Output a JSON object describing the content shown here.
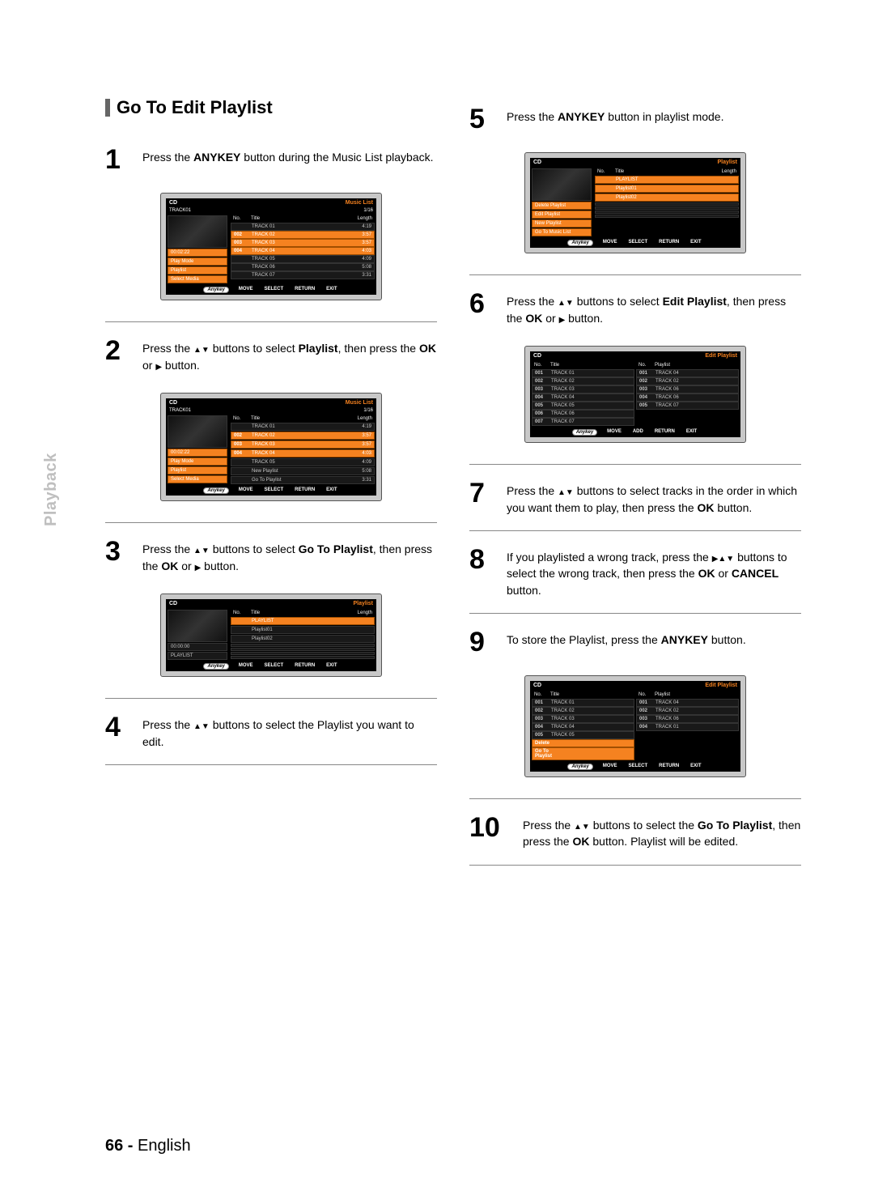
{
  "page": {
    "section_title": "Go To Edit Playlist",
    "sidebar": "Playback",
    "page_number": "66 -",
    "language": "English"
  },
  "glyphs": {
    "anykey": "Anykey",
    "move": "MOVE",
    "select": "SELECT",
    "add": "ADD",
    "return": "RETURN",
    "exit": "EXIT"
  },
  "steps": {
    "s1": {
      "num": "1",
      "pre": "Press the ",
      "bold": "ANYKEY",
      "post": " button during the Music List playback."
    },
    "s2": {
      "num": "2",
      "t1": "Press the ",
      "t2": " buttons to select ",
      "b2": "Playlist",
      "t3": ", then press the ",
      "b3": "OK",
      "t4": " or ",
      "t5": " button."
    },
    "s3": {
      "num": "3",
      "t1": "Press the ",
      "t2": " buttons to select ",
      "b2": "Go To Playlist",
      "t3": ", then press the ",
      "b3": "OK",
      "t4": " or ",
      "t5": " button."
    },
    "s4": {
      "num": "4",
      "t1": "Press the ",
      "t2": " buttons to select the Playlist you want to edit."
    },
    "s5": {
      "num": "5",
      "pre": "Press the ",
      "bold": "ANYKEY",
      "post": " button in playlist mode."
    },
    "s6": {
      "num": "6",
      "t1": "Press the ",
      "t2": " buttons to select ",
      "b2": "Edit Playlist",
      "t3": ", then press the ",
      "b3": "OK",
      "t4": " or ",
      "t5": " button."
    },
    "s7": {
      "num": "7",
      "t1": "Press the ",
      "t2": " buttons to select tracks in the order in which you want them to play, then press the ",
      "b2": "OK",
      "t3": " button."
    },
    "s8": {
      "num": "8",
      "t1": "If you playlisted a wrong track, press the ",
      "t2": " buttons to select the wrong track, then press the ",
      "b2": "OK",
      "t3": " or ",
      "b3": "CANCEL",
      "t4": " button."
    },
    "s9": {
      "num": "9",
      "t1": "To store the Playlist, press the ",
      "b1": "ANYKEY",
      "t2": " button."
    },
    "s10": {
      "num": "10",
      "t1": "Press the ",
      "t2": " buttons to select the ",
      "b2": "Go To Playlist",
      "t3": ", then press the ",
      "b3": "OK",
      "t4": " button. Playlist will be edited."
    }
  },
  "osd": {
    "musicList": {
      "cd": "CD",
      "header": "Music List",
      "track": "TRACK01",
      "counter": "1/16",
      "cols": {
        "no": "No.",
        "title": "Title",
        "length": "Length"
      },
      "time": "00:02:22",
      "menu": {
        "playMode": "Play Mode",
        "playlist": "Playlist",
        "selectMedia": "Select Media"
      },
      "rows1": [
        {
          "no": "",
          "title": "TRACK 01",
          "len": "4:19",
          "orange": false,
          "icon": true
        },
        {
          "no": "002",
          "title": "TRACK 02",
          "len": "3:57",
          "orange": true
        },
        {
          "no": "003",
          "title": "TRACK 03",
          "len": "3:57",
          "orange": true
        },
        {
          "no": "004",
          "title": "TRACK 04",
          "len": "4:03",
          "orange": true
        },
        {
          "no": "",
          "title": "TRACK 05",
          "len": "4:09",
          "orange": false
        },
        {
          "no": "",
          "title": "TRACK 06",
          "len": "5:08",
          "orange": false
        },
        {
          "no": "",
          "title": "TRACK 07",
          "len": "3:31",
          "orange": false
        }
      ],
      "playlistSub": {
        "new": "New Playlist",
        "go": "Go To Playlist"
      }
    },
    "playlist": {
      "cd": "CD",
      "header": "Playlist",
      "cols": {
        "no": "No.",
        "title": "Title",
        "length": "Length"
      },
      "time": "00:00:00",
      "rows": [
        {
          "title": "PLAYLIST",
          "orange": true
        },
        {
          "title": "Playlist01",
          "orange": false
        },
        {
          "title": "Playlist02",
          "orange": false
        }
      ],
      "leftMenu": {
        "playlist": "PLAYLIST"
      },
      "editMenu": {
        "delete": "Delete Playlist",
        "edit": "Edit Playlist",
        "new": "New Playlist",
        "go": "Go To Music List"
      }
    },
    "editPlaylist": {
      "cd": "CD",
      "header": "Edit Playlist",
      "leftHdr": {
        "no": "No.",
        "title": "Title"
      },
      "rightHdr": {
        "no": "No.",
        "title": "Playlist"
      },
      "left": [
        {
          "no": "001",
          "title": "TRACK 01"
        },
        {
          "no": "002",
          "title": "TRACK 02"
        },
        {
          "no": "003",
          "title": "TRACK 03"
        },
        {
          "no": "004",
          "title": "TRACK 04"
        },
        {
          "no": "005",
          "title": "TRACK 05"
        },
        {
          "no": "006",
          "title": "TRACK 06"
        },
        {
          "no": "007",
          "title": "TRACK 07"
        }
      ],
      "right": [
        {
          "no": "001",
          "title": "TRACK 04"
        },
        {
          "no": "002",
          "title": "TRACK 02"
        },
        {
          "no": "003",
          "title": "TRACK 06"
        },
        {
          "no": "004",
          "title": "TRACK 06"
        },
        {
          "no": "005",
          "title": "TRACK 07"
        }
      ]
    },
    "editPlaylist2": {
      "cd": "CD",
      "header": "Edit Playlist",
      "leftHdr": {
        "no": "No.",
        "title": "Title"
      },
      "rightHdr": {
        "no": "No.",
        "title": "Playlist"
      },
      "left": [
        {
          "no": "001",
          "title": "TRACK 01"
        },
        {
          "no": "002",
          "title": "TRACK 02"
        },
        {
          "no": "003",
          "title": "TRACK 03"
        },
        {
          "no": "004",
          "title": "TRACK 04"
        },
        {
          "no": "005",
          "title": "TRACK 05"
        },
        {
          "no": "Delete",
          "title": ""
        },
        {
          "no": "Go To Playlist",
          "title": ""
        }
      ],
      "right": [
        {
          "no": "001",
          "title": "TRACK 04"
        },
        {
          "no": "002",
          "title": "TRACK 02"
        },
        {
          "no": "003",
          "title": "TRACK 06"
        },
        {
          "no": "004",
          "title": "TRACK 01"
        }
      ]
    }
  }
}
